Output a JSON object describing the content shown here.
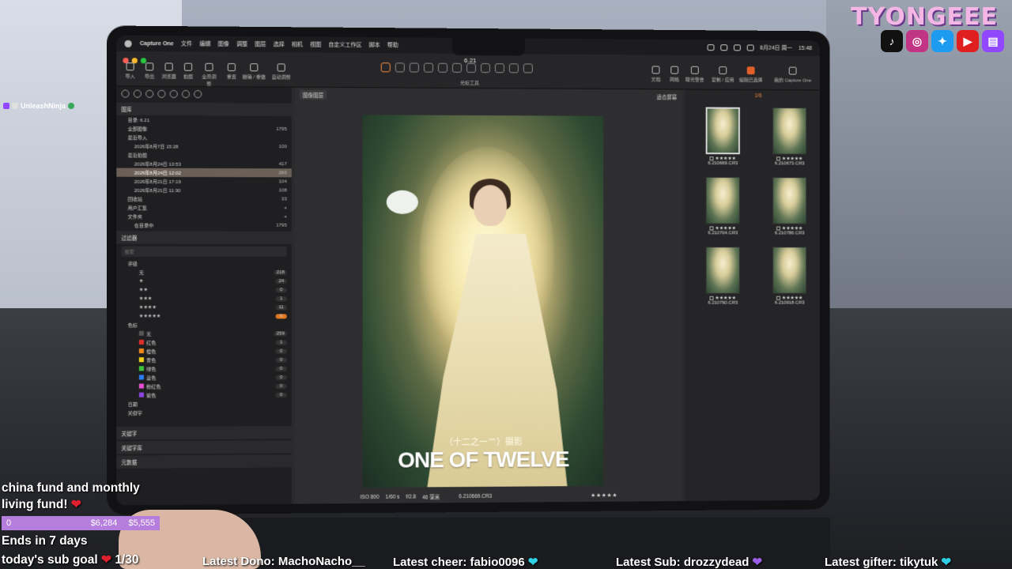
{
  "menubar": {
    "app": "Capture One",
    "items": [
      "文件",
      "编辑",
      "图像",
      "调整",
      "图层",
      "选择",
      "相机",
      "视图",
      "自定义工作区",
      "脚本",
      "帮助"
    ],
    "date": "8月24日 周一",
    "time": "15:48"
  },
  "window": {
    "doc_title": "6.21",
    "toolbar_left": [
      "导入",
      "导出",
      "浏览器",
      "拍摄",
      "全局调整",
      "重置",
      "撤销 / 重做",
      "自动调整"
    ],
    "toolbar_right": [
      "文档",
      "网格",
      "曝光警告",
      "复制 / 应用",
      "编辑已选择",
      "我的 Capture One"
    ],
    "cursor_label": "光标工具"
  },
  "library": {
    "header": "图库",
    "catalog": "目录: 6.21",
    "items": [
      {
        "label": "全部图像",
        "count": "1795"
      },
      {
        "label": "最近导入",
        "count": ""
      },
      {
        "label": "2026年8月7日 15:28",
        "count": "100"
      },
      {
        "label": "最近拍摄",
        "count": ""
      },
      {
        "label": "2026年8月24日 13:53",
        "count": "417"
      },
      {
        "label": "2026年8月24日 12:02",
        "count": "260",
        "selected": true
      },
      {
        "label": "2026年8月21日 17:19",
        "count": "104"
      },
      {
        "label": "2026年8月21日 11:30",
        "count": "108"
      },
      {
        "label": "回收站",
        "count": "33"
      }
    ],
    "user_collections": "用户汇集",
    "folders": "文件夹",
    "folder_item": {
      "label": "在目录中",
      "count": "1795"
    }
  },
  "filters": {
    "header": "过滤器",
    "search_placeholder": "搜索",
    "rating_header": "评级",
    "ratings": [
      {
        "label": "无",
        "count": "218"
      },
      {
        "label": "★",
        "count": "24"
      },
      {
        "label": "★★",
        "count": "0"
      },
      {
        "label": "★★★",
        "count": "1"
      },
      {
        "label": "★★★★",
        "count": "11"
      },
      {
        "label": "★★★★★",
        "count": "6"
      }
    ],
    "color_header": "色标",
    "colors": [
      {
        "label": "无",
        "count": "259",
        "color": "#555555"
      },
      {
        "label": "红色",
        "count": "1",
        "color": "#e0302a"
      },
      {
        "label": "橙色",
        "count": "0",
        "color": "#f08a1c"
      },
      {
        "label": "黄色",
        "count": "0",
        "color": "#f0d21c"
      },
      {
        "label": "绿色",
        "count": "0",
        "color": "#3cc23c"
      },
      {
        "label": "蓝色",
        "count": "0",
        "color": "#2b7cf0"
      },
      {
        "label": "粉红色",
        "count": "0",
        "color": "#e84fd0"
      },
      {
        "label": "紫色",
        "count": "0",
        "color": "#8a44e0"
      }
    ],
    "more": [
      "日期",
      "关键字"
    ]
  },
  "bottom_sections": [
    "关键字",
    "关键字库",
    "元数据"
  ],
  "viewer": {
    "mode": "图像图层",
    "fit": "适合屏幕",
    "photo_subtitle": "（十二之一™）摄影",
    "photo_title": "ONE OF TWELVE",
    "iso": "ISO 800",
    "shutter": "1/60 s",
    "aperture": "f/2.8",
    "focal": "46 毫米",
    "filename": "6.210669.CR3",
    "stars": "★★★★★"
  },
  "browser": {
    "count": "1/6",
    "thumbnails": [
      {
        "name": "6.210669.CR3",
        "selected": true
      },
      {
        "name": "6.210673.CR3",
        "selected": false
      },
      {
        "name": "6.210704.CR3",
        "selected": false
      },
      {
        "name": "6.210786.CR3",
        "selected": false
      },
      {
        "name": "6.210790.CR3",
        "selected": false
      },
      {
        "name": "6.210918.CR3",
        "selected": false
      }
    ],
    "stars": "★★★★★"
  },
  "overlay": {
    "brand": "TYONGEEE",
    "socials": [
      "tiktok-icon",
      "instagram-icon",
      "twitter-icon",
      "youtube-icon",
      "twitch-icon"
    ],
    "chat_user": "UnleashNinja",
    "goal_text_line1": "china fund and monthly",
    "goal_text_line2": "living fund!",
    "goal_start": "0",
    "goal_current": "$6,284",
    "goal_target": "$5,555",
    "goal_progress": 1.0,
    "ends": "Ends in 7 days",
    "sub_goal_label": "today's sub goal",
    "sub_goal_value": "1/30",
    "latest_dono": "Latest Dono: MachoNacho__",
    "latest_cheer": "Latest cheer: fabio0096",
    "latest_sub": "Latest Sub: drozzydead",
    "latest_gifter": "Latest gifter: tikytuk"
  }
}
